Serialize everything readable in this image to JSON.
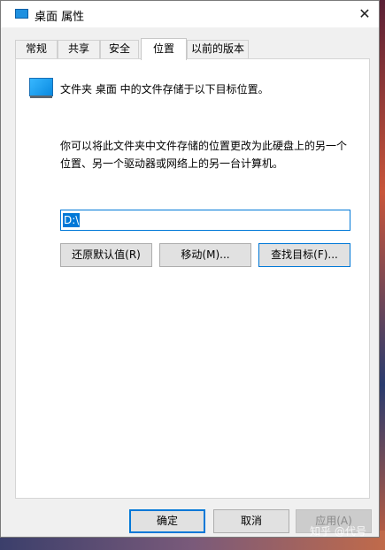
{
  "window": {
    "title": "桌面 属性",
    "close_glyph": "✕"
  },
  "tabs": [
    {
      "label": "常规",
      "active": false
    },
    {
      "label": "共享",
      "active": false
    },
    {
      "label": "安全",
      "active": false
    },
    {
      "label": "位置",
      "active": true
    },
    {
      "label": "以前的版本",
      "active": false
    }
  ],
  "location": {
    "header": "文件夹 桌面 中的文件存储于以下目标位置。",
    "description_line1": "你可以将此文件夹中文件存储的位置更改为此硬盘上的另一个",
    "description_line2": "位置、另一个驱动器或网络上的另一台计算机。",
    "path_value": "D:\\",
    "restore_button": "还原默认值(R)",
    "move_button": "移动(M)...",
    "find_target_button": "查找目标(F)..."
  },
  "footer": {
    "ok_button": "确定",
    "cancel_button": "取消",
    "apply_button": "应用(A)"
  },
  "watermark": "知乎 @代号",
  "colors": {
    "accent": "#0078d7",
    "folder_blue": "#1e90e0"
  }
}
